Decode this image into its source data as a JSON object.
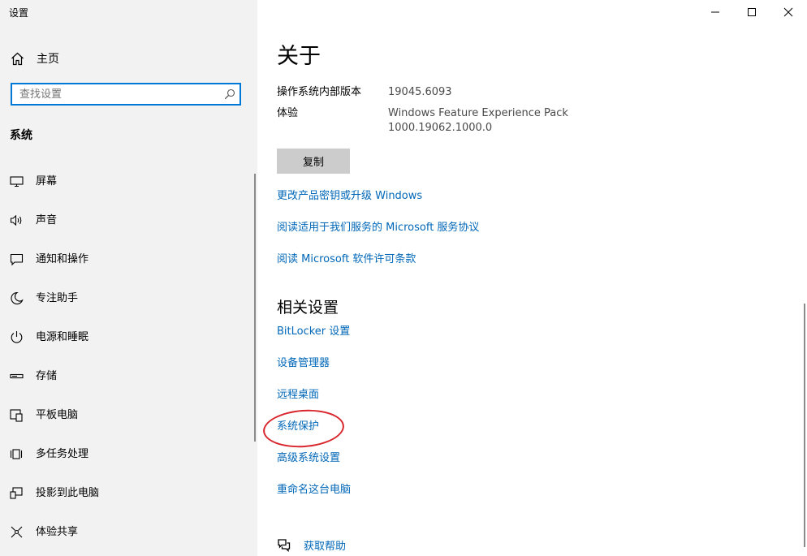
{
  "window": {
    "title": "设置"
  },
  "sidebar": {
    "home_label": "主页",
    "search_placeholder": "查找设置",
    "section_title": "系统",
    "items": [
      {
        "label": "屏幕"
      },
      {
        "label": "声音"
      },
      {
        "label": "通知和操作"
      },
      {
        "label": "专注助手"
      },
      {
        "label": "电源和睡眠"
      },
      {
        "label": "存储"
      },
      {
        "label": "平板电脑"
      },
      {
        "label": "多任务处理"
      },
      {
        "label": "投影到此电脑"
      },
      {
        "label": "体验共享"
      }
    ]
  },
  "main": {
    "title": "关于",
    "specs": [
      {
        "label": "操作系统内部版本",
        "value": "19045.6093"
      },
      {
        "label": "体验",
        "value_line1": "Windows Feature Experience Pack",
        "value_line2": "1000.19062.1000.0"
      }
    ],
    "copy_label": "复制",
    "links": [
      "更改产品密钥或升级 Windows",
      "阅读适用于我们服务的 Microsoft 服务协议",
      "阅读 Microsoft 软件许可条款"
    ],
    "related_title": "相关设置",
    "related_links": [
      "BitLocker 设置",
      "设备管理器",
      "远程桌面",
      "系统保护",
      "高级系统设置",
      "重命名这台电脑"
    ],
    "help_label": "获取帮助"
  },
  "colors": {
    "accent": "#0078d7",
    "link": "#0067b8",
    "annotation": "#d9262d",
    "sidebar_bg": "#f2f2f2"
  }
}
